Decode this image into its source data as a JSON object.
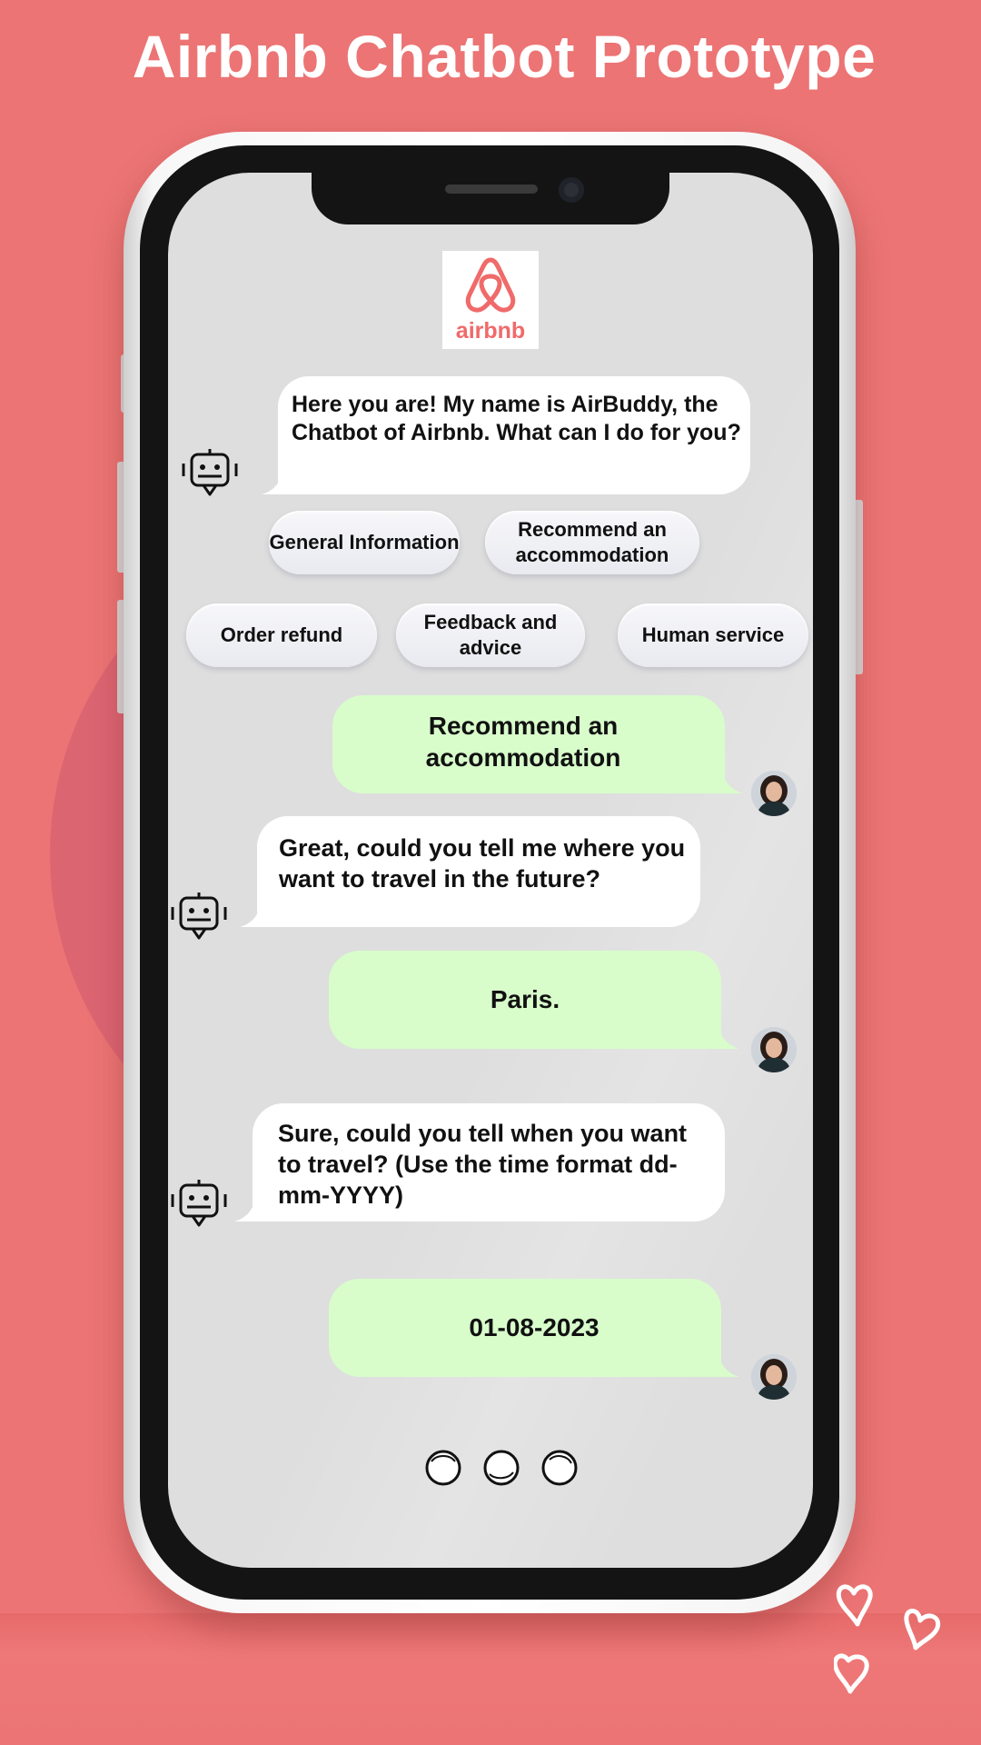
{
  "page": {
    "title": "Airbnb Chatbot Prototype"
  },
  "app": {
    "logo_text": "airbnb",
    "logo_icon": "airbnb-belo-icon"
  },
  "colors": {
    "background": "#ec7474",
    "bot_bubble": "#ffffff",
    "user_bubble": "#d8fdcb",
    "brand": "#f06a6a",
    "screen": "#dedede"
  },
  "chat": {
    "messages": [
      {
        "sender": "bot",
        "text": "Here you are! My name is AirBuddy, the Chatbot of Airbnb. What can I do for you?"
      },
      {
        "sender": "user",
        "text": "Recommend an accommodation"
      },
      {
        "sender": "bot",
        "text": "Great, could you tell me where you want to travel in the future?"
      },
      {
        "sender": "user",
        "text": "Paris."
      },
      {
        "sender": "bot",
        "text": "Sure, could you tell when you want to travel? (Use the time format dd-mm-YYYY)"
      },
      {
        "sender": "user",
        "text": "01-08-2023"
      }
    ],
    "quick_replies": [
      "General Information",
      "Recommend an accommodation",
      "Order refund",
      "Feedback and advice",
      "Human service"
    ],
    "bot_icon": "robot-icon",
    "user_avatar": "avatar-photo",
    "typing_indicator": "typing-dots-icon"
  }
}
